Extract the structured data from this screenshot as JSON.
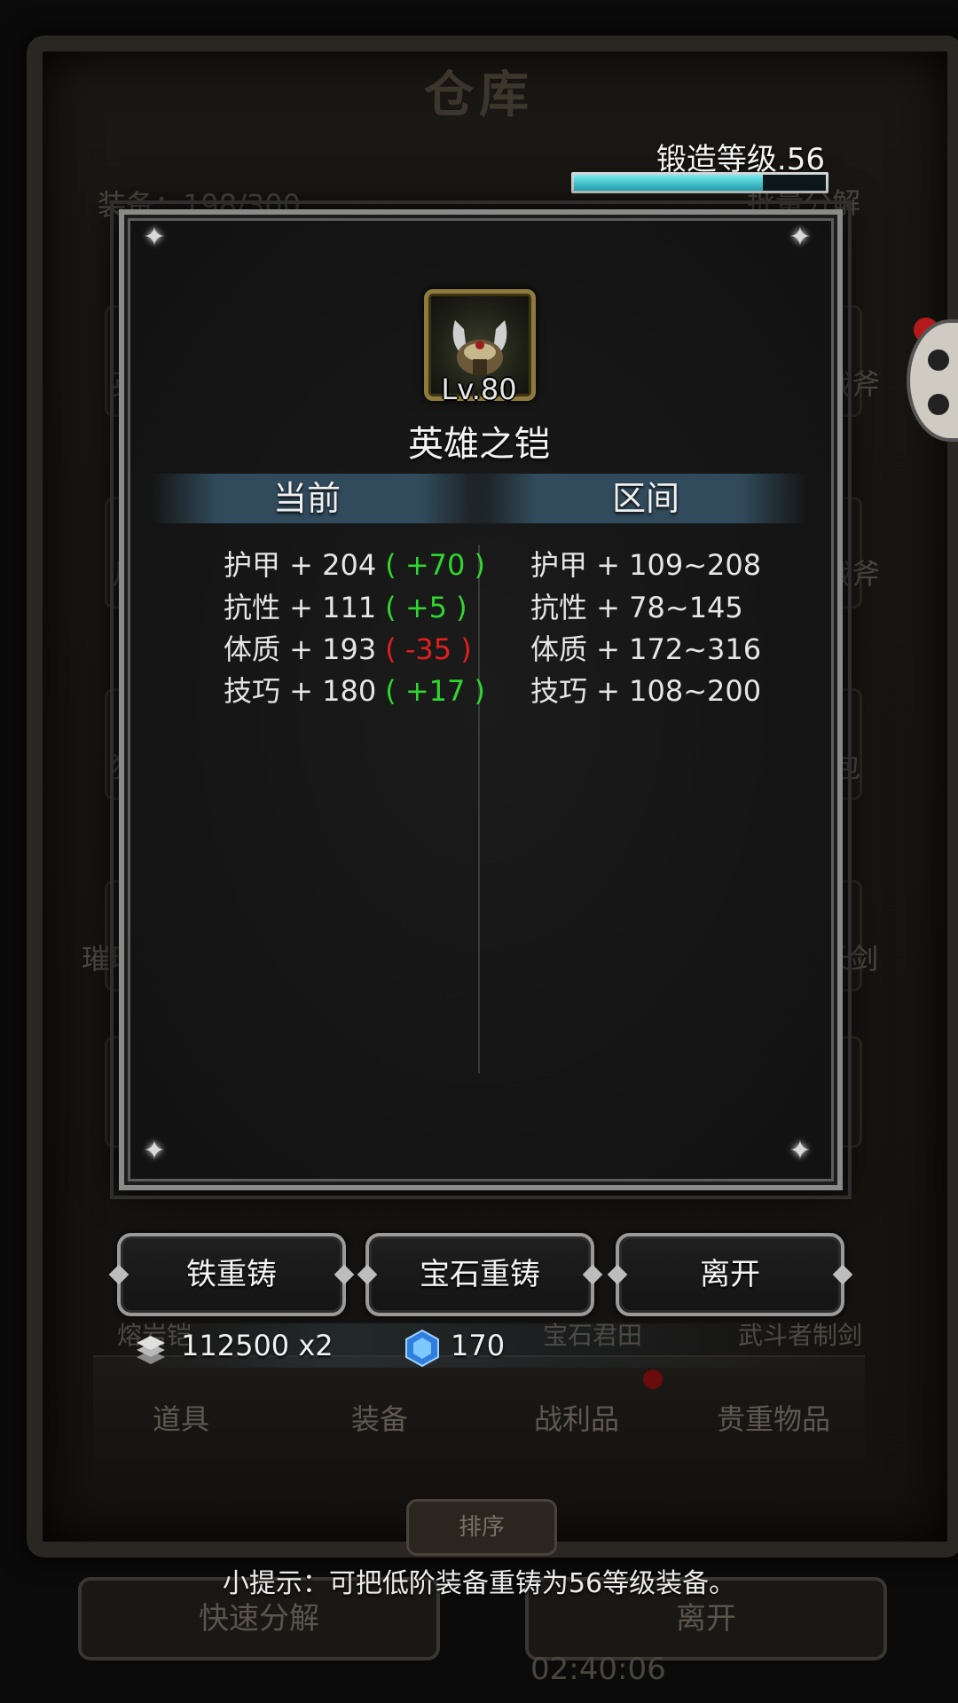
{
  "background": {
    "title": "仓库",
    "equipment_count": "装备：198/300",
    "batch_decompose": "批量分解",
    "list_fragments": [
      "英",
      "战斧",
      "战斧",
      "月",
      "猎",
      "包",
      "璀璨",
      "长剑",
      "熔岩铠",
      "宝石君田",
      "武斗者制剑"
    ],
    "tabs": [
      "道具",
      "装备",
      "战利品",
      "贵重物品"
    ],
    "sort_label": "排序",
    "quick_decompose": "快速分解",
    "leave": "离开",
    "timer": "02:40:06"
  },
  "forge": {
    "label": "锻造等级.56",
    "progress": 0.75
  },
  "item": {
    "icon": "horned-helmet-armor-icon",
    "level": "Lv.80",
    "name": "英雄之铠"
  },
  "columns": {
    "current": "当前",
    "range": "区间"
  },
  "current_stats": [
    {
      "label": "护甲 + 204",
      "delta": "+70",
      "positive": true
    },
    {
      "label": "抗性 + 111",
      "delta": "+5",
      "positive": true
    },
    {
      "label": "体质 + 193",
      "delta": "-35",
      "positive": false
    },
    {
      "label": "技巧 + 180",
      "delta": "+17",
      "positive": true
    }
  ],
  "range_stats": [
    "护甲 + 109~208",
    "抗性 + 78~145",
    "体质 + 172~316",
    "技巧 + 108~200"
  ],
  "buttons": {
    "iron_reforge": "铁重铸",
    "gem_reforge": "宝石重铸",
    "leave": "离开"
  },
  "costs": {
    "iron": "112500 x2",
    "gem": "170"
  },
  "hint": "小提示：可把低阶装备重铸为56等级装备。",
  "colors": {
    "positive": "#2fd62f",
    "negative": "#e01f1f",
    "forge_bar": "#4fd8e0"
  }
}
